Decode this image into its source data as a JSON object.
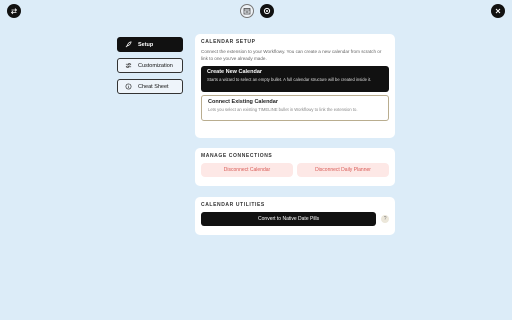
{
  "nav": {
    "items": [
      {
        "label": "Setup",
        "icon": "rocket-icon"
      },
      {
        "label": "Customization",
        "icon": "sliders-icon"
      },
      {
        "label": "Cheat Sheet",
        "icon": "info-icon"
      }
    ]
  },
  "setup": {
    "title": "CALENDAR SETUP",
    "description": "Connect the extension to your Workflowy. You can create a new calendar from scratch or link to one you've already made.",
    "create": {
      "title": "Create New Calendar",
      "description": "Starts a wizard to select an empty bullet. A full calendar structure will be created inside it."
    },
    "connect": {
      "title": "Connect Existing Calendar",
      "description": "Lets you select an existing TIMELINE bullet in Workflowy to link the extension to."
    }
  },
  "connections": {
    "title": "MANAGE CONNECTIONS",
    "disconnect_calendar": "Disconnect Calendar",
    "disconnect_planner": "Disconnect Daily Planner"
  },
  "utilities": {
    "title": "CALENDAR UTILITIES",
    "convert_label": "Convert to Native Date Pills",
    "help_glyph": "?"
  },
  "colors": {
    "background": "#dcecf8",
    "dark": "#111111",
    "danger_bg": "#fde8e6",
    "danger_text": "#d85a55"
  }
}
